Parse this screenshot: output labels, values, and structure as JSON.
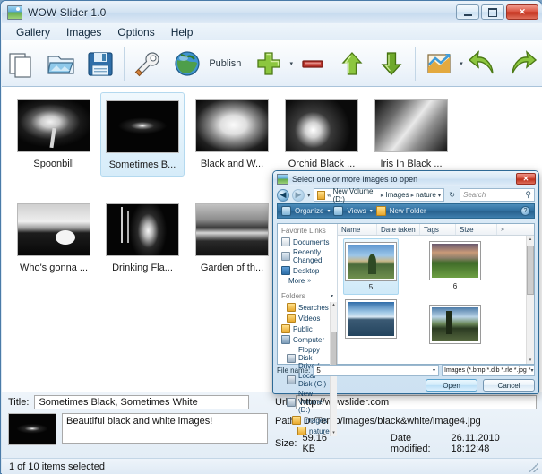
{
  "app": {
    "title": "WOW Slider 1.0",
    "icon": "app-image-icon",
    "window_buttons": {
      "minimize": "–",
      "maximize": "□",
      "close": "✕"
    }
  },
  "menu": {
    "items": [
      "Gallery",
      "Images",
      "Options",
      "Help"
    ]
  },
  "toolbar": {
    "buttons": [
      {
        "name": "new-gallery",
        "icon": "new-document-icon",
        "label": ""
      },
      {
        "name": "open-gallery",
        "icon": "open-folder-icon",
        "label": ""
      },
      {
        "name": "save-gallery",
        "icon": "save-floppy-icon",
        "label": ""
      },
      {
        "name": "properties",
        "icon": "wrench-icon",
        "label": ""
      },
      {
        "name": "publish",
        "icon": "globe-icon",
        "label": "Publish"
      },
      {
        "name": "add-images",
        "icon": "plus-icon",
        "label": ""
      },
      {
        "name": "remove-images",
        "icon": "minus-icon",
        "label": ""
      },
      {
        "name": "move-up",
        "icon": "arrow-up-icon",
        "label": ""
      },
      {
        "name": "move-down",
        "icon": "arrow-down-icon",
        "label": ""
      },
      {
        "name": "effects",
        "icon": "chart-icon",
        "label": ""
      },
      {
        "name": "undo",
        "icon": "undo-arrow-icon",
        "label": ""
      },
      {
        "name": "redo",
        "icon": "redo-arrow-icon",
        "label": ""
      }
    ],
    "publish_label": "Publish",
    "caret": "▾"
  },
  "gallery": {
    "thumbnails": [
      {
        "caption": "Spoonbill",
        "art": "ph-spoonbill",
        "selected": false
      },
      {
        "caption": "Sometimes B...",
        "art": "ph-night",
        "selected": true
      },
      {
        "caption": "Black and W...",
        "art": "ph-orchid",
        "selected": false
      },
      {
        "caption": "Orchid Black ...",
        "art": "ph-orchid2",
        "selected": false
      },
      {
        "caption": "Iris In Black ...",
        "art": "ph-iris",
        "selected": false
      },
      {
        "caption": "Who's gonna ...",
        "art": "ph-horses",
        "selected": false
      },
      {
        "caption": "Drinking Fla...",
        "art": "ph-flamingo",
        "selected": false
      },
      {
        "caption": "Garden of th...",
        "art": "ph-garden",
        "selected": false
      }
    ]
  },
  "file_dialog": {
    "title": "Select one or more images to open",
    "close_glyph": "✕",
    "nav": {
      "back": "◀",
      "forward": "▶",
      "dropdown": "▾",
      "breadcrumb": [
        "New Volume (D:)",
        "Images",
        "nature"
      ],
      "breadcrumb_prefix": "«",
      "separator": "▸",
      "refresh": "↻",
      "search_placeholder": "Search",
      "search_icon": "⚲"
    },
    "commands": {
      "organize": "Organize",
      "views": "Views",
      "new_folder": "New Folder",
      "caret": "▾",
      "help": "?"
    },
    "sidebar": {
      "favorites_header": "Favorite Links",
      "favorites": [
        "Documents",
        "Recently Changed",
        "Desktop"
      ],
      "more": "More",
      "more_glyph": "»",
      "folders_header": "Folders",
      "folders_chevron": "▾",
      "tree": [
        {
          "label": "Searches",
          "indent": 1,
          "icon": "ic-folder"
        },
        {
          "label": "Videos",
          "indent": 1,
          "icon": "ic-folder"
        },
        {
          "label": "Public",
          "indent": 0,
          "icon": "ic-folder"
        },
        {
          "label": "Computer",
          "indent": 0,
          "icon": "ic-comp"
        },
        {
          "label": "Floppy Disk Drive (",
          "indent": 1,
          "icon": "ic-drive"
        },
        {
          "label": "Local Disk (C:)",
          "indent": 1,
          "icon": "ic-drive"
        },
        {
          "label": "New Volume (D:)",
          "indent": 1,
          "icon": "ic-drive"
        },
        {
          "label": "Images",
          "indent": 2,
          "icon": "ic-folder"
        },
        {
          "label": "nature",
          "indent": 3,
          "icon": "ic-folder"
        }
      ]
    },
    "columns": [
      "Name",
      "Date taken",
      "Tags",
      "Size"
    ],
    "column_extra": "»",
    "files": [
      {
        "name": "5",
        "art": "nt1",
        "selected": true
      },
      {
        "name": "6",
        "art": "nt2",
        "selected": false
      },
      {
        "name": "",
        "art": "nt3",
        "selected": false
      },
      {
        "name": "",
        "art": "nt4",
        "selected": false
      }
    ],
    "footer": {
      "file_name_label": "File name:",
      "file_name_value": "5",
      "file_type_value": "Images (*.bmp *.dib *.rle *.jpg *",
      "dropdown": "▾",
      "open_button": "Open",
      "cancel_button": "Cancel"
    },
    "scroll_up": "▴",
    "scroll_down": "▾"
  },
  "info": {
    "title_label": "Title:",
    "title_value": "Sometimes Black, Sometimes White",
    "description_value": "Beautiful  black and white images!",
    "url_label": "Url:",
    "url_value": "http://wowslider.com",
    "path_label": "Path:",
    "path_value": "D:/Temp/images/black&white/image4.jpg",
    "size_label": "Size:",
    "size_value": "59.16 KB",
    "date_modified_label": "Date modified:",
    "date_modified_value": "26.11.2010 18:12:48"
  },
  "status": {
    "text": "1 of 10 items selected"
  }
}
